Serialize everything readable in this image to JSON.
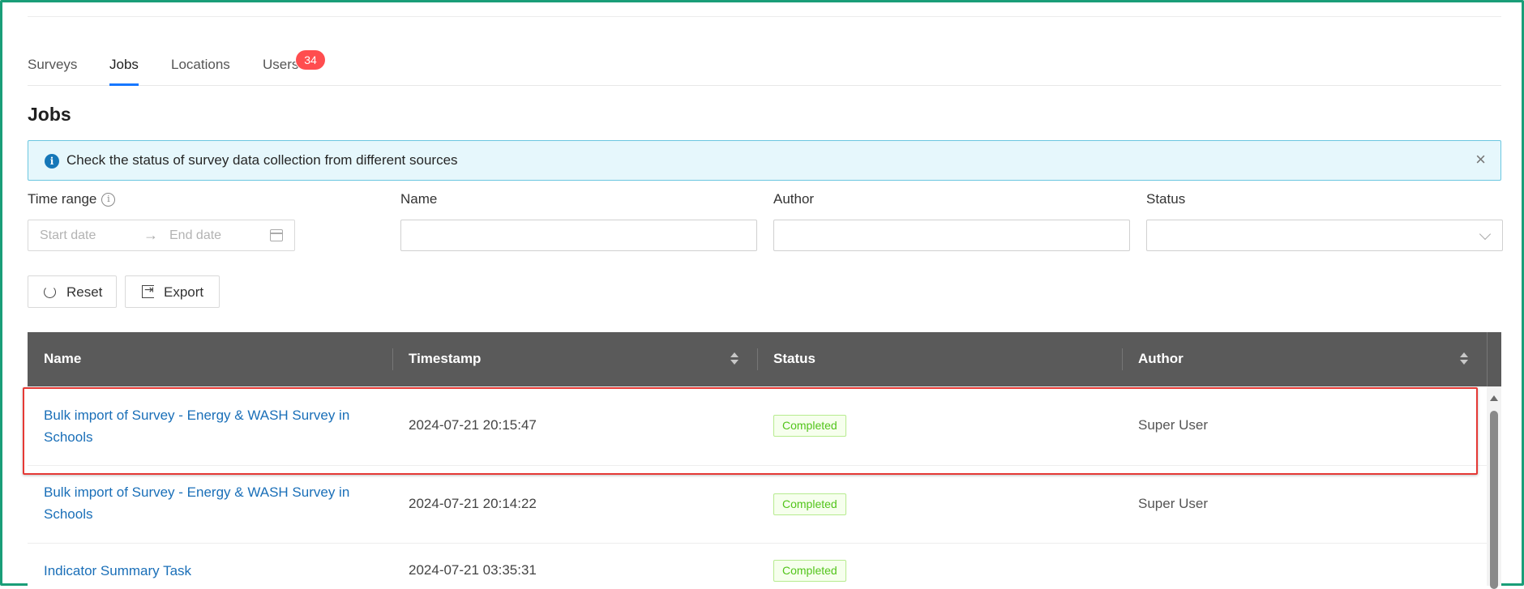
{
  "tabs": [
    {
      "label": "Surveys",
      "active": false
    },
    {
      "label": "Jobs",
      "active": true
    },
    {
      "label": "Locations",
      "active": false
    },
    {
      "label": "Users",
      "active": false,
      "badge": "34"
    }
  ],
  "page": {
    "title": "Jobs"
  },
  "alert": {
    "icon": "info-icon",
    "text": "Check the status of survey data collection from different sources",
    "close_icon": "close-icon"
  },
  "filters": {
    "time_range": {
      "label": "Time range",
      "start_placeholder": "Start date",
      "end_placeholder": "End date"
    },
    "name": {
      "label": "Name",
      "value": ""
    },
    "author": {
      "label": "Author",
      "value": ""
    },
    "status": {
      "label": "Status",
      "value": ""
    }
  },
  "buttons": {
    "reset_label": "Reset",
    "export_label": "Export"
  },
  "table": {
    "columns": [
      "Name",
      "Timestamp",
      "Status",
      "Author"
    ],
    "rows": [
      {
        "name_line1": "Bulk import of Survey - Energy & WASH Survey in",
        "name_line2": "Schools",
        "timestamp": "2024-07-21 20:15:47",
        "status": "Completed",
        "author": "Super User",
        "highlighted": true
      },
      {
        "name_line1": "Bulk import of Survey - Energy & WASH Survey in",
        "name_line2": "Schools",
        "timestamp": "2024-07-21 20:14:22",
        "status": "Completed",
        "author": "Super User"
      },
      {
        "name_line1": "Indicator Summary Task",
        "name_line2": "",
        "timestamp": "2024-07-21 03:35:31",
        "status": "Completed",
        "author": ""
      }
    ]
  },
  "colors": {
    "frame": "#1a9e78",
    "active_tab": "#1677ff",
    "badge": "#ff4d4f",
    "link": "#1a6fb8",
    "table_header": "#5a5a5a",
    "status_completed": "#52c41a",
    "highlight": "#e53935"
  }
}
